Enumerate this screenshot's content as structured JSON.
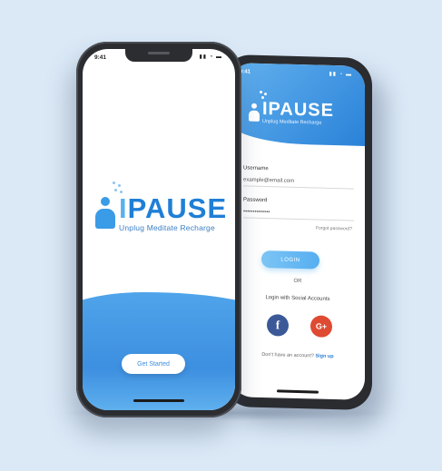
{
  "colors": {
    "background": "#dbe9f7",
    "primary_blue": "#2a82d8",
    "facebook": "#3b5998",
    "google_plus": "#df4a32"
  },
  "back_phone": {
    "status_time": "9:41",
    "status_icons": "signal-wifi-battery-icons",
    "logo": {
      "brand": "IPAUSE",
      "tagline": "Unplug Meditate Recharge",
      "icon": "meditating-person-icon"
    },
    "username_label": "Username",
    "username_value": "example@email.com",
    "password_label": "Password",
    "password_value": "••••••••••••••",
    "forgot_password": "Forgot password?",
    "login_button": "LOGIN",
    "or_text": "OR",
    "social_title": "Login with Social Accounts",
    "facebook_icon": "f",
    "google_icon": "G+",
    "signup_prompt": "Don't have an account?",
    "signup_link": "Sign up"
  },
  "front_phone": {
    "status_time": "9:41",
    "status_icons": "signal-wifi-battery-icons",
    "logo": {
      "brand_i": "I",
      "brand_rest": "PAUSE",
      "tagline": "Unplug  Meditate  Recharge",
      "icon": "meditating-person-icon"
    },
    "get_started_button": "Get Started"
  }
}
